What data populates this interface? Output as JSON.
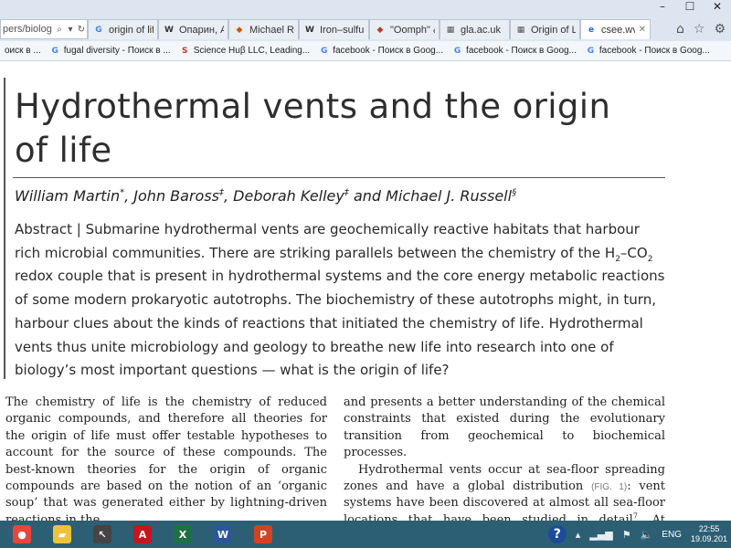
{
  "browser": {
    "address_url": "pers/biolog",
    "window_controls": {
      "minimize": "–",
      "maximize": "☐",
      "close": "✕"
    },
    "tabs": [
      {
        "label": "origin of life...",
        "favicon": "G",
        "favicon_color": "#4285f4",
        "active": false
      },
      {
        "label": "Опарин, Ал...",
        "favicon": "W",
        "favicon_color": "#333333",
        "active": false
      },
      {
        "label": "Michael Rus...",
        "favicon": "◆",
        "favicon_color": "#d35400",
        "active": false
      },
      {
        "label": "Iron–sulfur ...",
        "favicon": "W",
        "favicon_color": "#333333",
        "active": false
      },
      {
        "label": "\"Oomph\" &...",
        "favicon": "◆",
        "favicon_color": "#c0392b",
        "active": false
      },
      {
        "label": "gla.ac.uk",
        "favicon": "▦",
        "favicon_color": "#555555",
        "active": false
      },
      {
        "label": "Origin of Lif...",
        "favicon": "▦",
        "favicon_color": "#555555",
        "active": false
      },
      {
        "label": "csee.wvu....",
        "favicon": "e",
        "favicon_color": "#1e6ec8",
        "active": true
      }
    ],
    "home_icon": "home-icon",
    "favorites_icon": "star-icon",
    "settings_icon": "gear-icon"
  },
  "bookmarks": [
    {
      "label": "оиск в ...",
      "icon": "none"
    },
    {
      "label": "fugal diversity - Поиск в ...",
      "icon": "G"
    },
    {
      "label": "Science Huβ LLC, Leading...",
      "icon": "S"
    },
    {
      "label": "facebook - Поиск в Goog...",
      "icon": "G"
    },
    {
      "label": "facebook - Поиск в Goog...",
      "icon": "G"
    },
    {
      "label": "facebook - Поиск в Goog...",
      "icon": "G"
    }
  ],
  "article": {
    "title_line1": "Hydrothermal vents and the origin",
    "title_line2": "of life",
    "authors": [
      {
        "name": "William Martin",
        "mark": "*"
      },
      {
        "name": "John Baross",
        "mark": "‡"
      },
      {
        "name": "Deborah Kelley",
        "mark": "‡"
      },
      {
        "name": "Michael J. Russell",
        "mark": "§"
      }
    ],
    "abstract_label": "Abstract | ",
    "abstract_part1": "Submarine hydrothermal vents are geochemically reactive habitats that harbour rich microbial communities. There are striking parallels between the chemistry of the H",
    "abstract_sub1": "2",
    "abstract_dash": "–CO",
    "abstract_sub2": "2",
    "abstract_part2": " redox couple that is present in hydrothermal systems and the core energy metabolic reactions of some modern prokaryotic autotrophs. The biochemistry of these autotrophs might, in turn, harbour clues about the kinds of reactions that initiated the chemistry of life. Hydrothermal vents thus unite microbiology and geology to breathe new life into research into one of biology’s most important questions — what is the origin of life?",
    "col1": "The chemistry of life is the chemistry of reduced organic compounds, and therefore all theories for the origin of life must offer testable hypotheses to account for the source of these compounds. The best-known theories for the origin of organic compounds are based on the notion of an ‘organic soup’ that was generated either by lightning-driven reactions in the",
    "col2_para1": "and presents a better understanding of the chemical constraints that existed during the evolutionary transition from geochemical to biochemical processes.",
    "col2_para2_a": "Hydrothermal vents occur at sea-floor spreading zones and have a global distribution ",
    "col2_figref": "(FIG. 1)",
    "col2_para2_b": ": vent systems have been discovered at almost all sea-floor locations that have been studied in detail",
    "col2_ref": "7",
    "col2_para2_c": ". At spreading zones,"
  },
  "taskbar": {
    "apps": [
      {
        "name": "chrome",
        "glyph": "●",
        "color": "#e8453c"
      },
      {
        "name": "windows-explorer",
        "glyph": "▰",
        "color": "#f0c23c"
      },
      {
        "name": "cursor-app",
        "glyph": "↖",
        "color": "#444444"
      },
      {
        "name": "pdf-reader",
        "glyph": "A",
        "color": "#c4161c"
      },
      {
        "name": "excel",
        "glyph": "X",
        "color": "#1e7145"
      },
      {
        "name": "word",
        "glyph": "W",
        "color": "#2b579a"
      },
      {
        "name": "powerpoint",
        "glyph": "P",
        "color": "#d04423"
      }
    ],
    "tray": {
      "help": "?",
      "language": "ENG",
      "time": "22:55",
      "date": "19.09.201"
    }
  }
}
